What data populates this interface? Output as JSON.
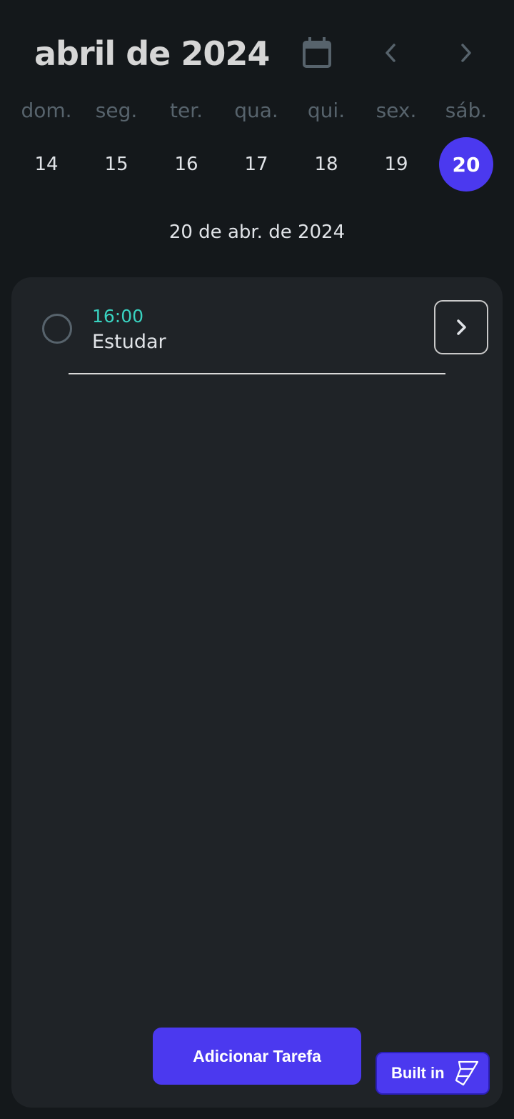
{
  "header": {
    "month_title": "abril de 2024",
    "icons": {
      "calendar": "calendar-icon",
      "prev": "chevron-left-icon",
      "next": "chevron-right-icon"
    }
  },
  "weekdays": [
    "dom.",
    "seg.",
    "ter.",
    "qua.",
    "qui.",
    "sex.",
    "sáb."
  ],
  "days": [
    "14",
    "15",
    "16",
    "17",
    "18",
    "19",
    "20"
  ],
  "selected_day": "20",
  "selected_date_label": "20 de abr. de 2024",
  "tasks": [
    {
      "time": "16:00",
      "title": "Estudar",
      "completed": false
    }
  ],
  "add_button_label": "Adicionar Tarefa",
  "built_badge_label": "Built in",
  "colors": {
    "background": "#14181b",
    "panel": "#1f2327",
    "accent": "#4b39ef",
    "time_text": "#39d2c0",
    "muted": "#57636c"
  }
}
